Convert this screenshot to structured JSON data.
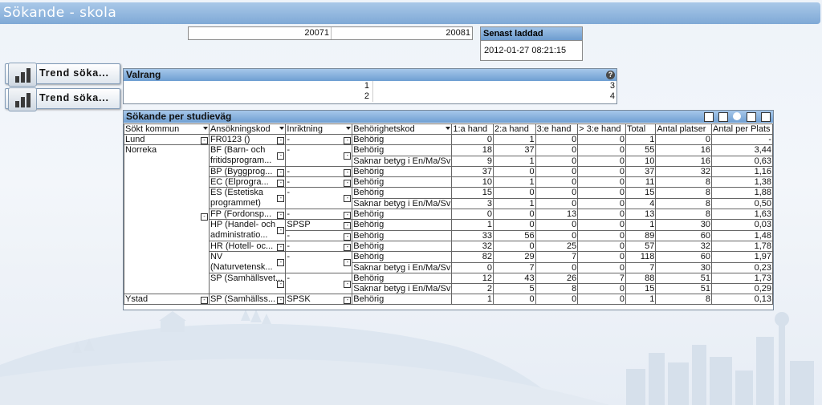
{
  "app": {
    "title": "Sökande - skola"
  },
  "year_filter": {
    "left": "20071",
    "right": "20081"
  },
  "loaded": {
    "label": "Senast laddad",
    "value": "2012-01-27 08:21:15"
  },
  "trend_buttons": [
    {
      "label": "Trend söka..."
    },
    {
      "label": "Trend söka..."
    }
  ],
  "valrang": {
    "title": "Valrang",
    "rows": [
      {
        "left": "1",
        "right": "3"
      },
      {
        "left": "2",
        "right": "4"
      }
    ]
  },
  "pivot": {
    "title": "Sökande per studieväg",
    "headers": [
      "Sökt kommun",
      "Ansökningskod",
      "Inriktning",
      "Behörighetskod",
      "1:a hand",
      "2:a hand",
      "3:e hand",
      "> 3:e hand",
      "Total",
      "Antal platser",
      "Antal per Plats"
    ],
    "kommun": {
      "lund": "Lund",
      "norreka": "Norreka",
      "ystad": "Ystad"
    },
    "codes": {
      "fr": "FR0123 ()",
      "bf": "BF (Barn- och fritidsprogram...",
      "bp": "BP (Byggprog...",
      "ec": "EC (Elprogra...",
      "es": "ES (Estetiska programmet)",
      "fp": "FP (Fordonsp...",
      "hp": "HP (Handel- och administratio...",
      "hr": "HR (Hotell- oc...",
      "nv": "NV (Naturvetensk...",
      "sp": "SP (Samhällsvet...",
      "sp2": "SP (Samhällss..."
    },
    "inr": {
      "dash": "-",
      "spsp": "SPSP",
      "spsk": "SPSK"
    },
    "beh": {
      "b": "Behörig",
      "s": "Saknar betyg i En/Ma/Sv"
    },
    "rows": [
      {
        "v": [
          "0",
          "1",
          "0",
          "0",
          "1",
          "0",
          "-"
        ]
      },
      {
        "v": [
          "18",
          "37",
          "0",
          "0",
          "55",
          "16",
          "3,44"
        ]
      },
      {
        "v": [
          "9",
          "1",
          "0",
          "0",
          "10",
          "16",
          "0,63"
        ]
      },
      {
        "v": [
          "37",
          "0",
          "0",
          "0",
          "37",
          "32",
          "1,16"
        ]
      },
      {
        "v": [
          "10",
          "1",
          "0",
          "0",
          "11",
          "8",
          "1,38"
        ]
      },
      {
        "v": [
          "15",
          "0",
          "0",
          "0",
          "15",
          "8",
          "1,88"
        ]
      },
      {
        "v": [
          "3",
          "1",
          "0",
          "0",
          "4",
          "8",
          "0,50"
        ]
      },
      {
        "v": [
          "0",
          "0",
          "13",
          "0",
          "13",
          "8",
          "1,63"
        ]
      },
      {
        "v": [
          "1",
          "0",
          "0",
          "0",
          "1",
          "30",
          "0,03"
        ]
      },
      {
        "v": [
          "33",
          "56",
          "0",
          "0",
          "89",
          "60",
          "1,48"
        ]
      },
      {
        "v": [
          "32",
          "0",
          "25",
          "0",
          "57",
          "32",
          "1,78"
        ]
      },
      {
        "v": [
          "82",
          "29",
          "7",
          "0",
          "118",
          "60",
          "1,97"
        ]
      },
      {
        "v": [
          "0",
          "7",
          "0",
          "0",
          "7",
          "30",
          "0,23"
        ]
      },
      {
        "v": [
          "12",
          "43",
          "26",
          "7",
          "88",
          "51",
          "1,73"
        ]
      },
      {
        "v": [
          "2",
          "5",
          "8",
          "0",
          "15",
          "51",
          "0,29"
        ]
      },
      {
        "v": [
          "1",
          "0",
          "0",
          "0",
          "1",
          "8",
          "0,13"
        ]
      }
    ]
  }
}
